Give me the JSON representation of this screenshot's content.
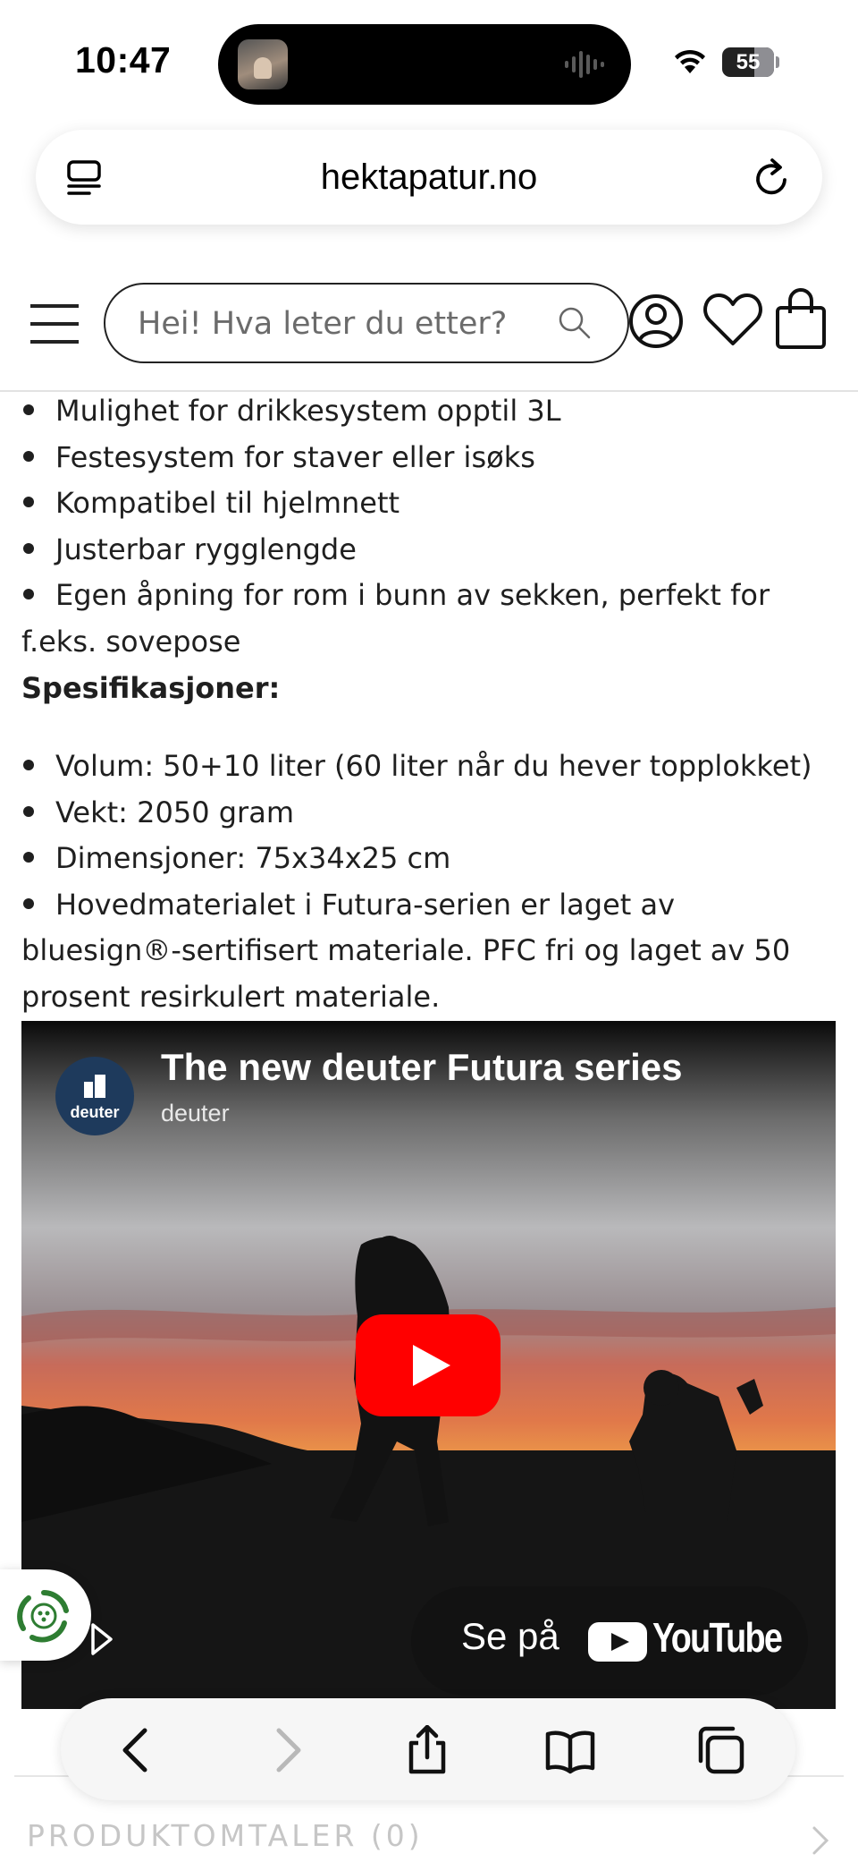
{
  "status_bar": {
    "time": "10:47",
    "battery_percent": "55"
  },
  "browser": {
    "url": "hektapatur.no"
  },
  "site_header": {
    "search_placeholder": "Hei! Hva leter du etter?"
  },
  "content": {
    "features": [
      "Mulighet for drikkesystem opptil 3L",
      "Festesystem for staver eller isøks",
      "Kompatibel til hjelmnett",
      "Justerbar rygglengde",
      "Egen åpning for rom i bunn av sekken, perfekt for f.eks. sovepose"
    ],
    "spec_heading": "Spesifikasjoner:",
    "specs": [
      "Volum: 50+10 liter (60 liter når du hever topplokket)",
      "Vekt: 2050 gram",
      "Dimensjoner: 75x34x25 cm",
      "Hovedmaterialet i Futura-serien er laget av bluesign®-sertifisert materiale. PFC fri og laget av 50 prosent resirkulert materiale."
    ]
  },
  "video": {
    "channel_avatar_text": "deuter",
    "title": "The new deuter Futura series",
    "channel": "deuter",
    "watch_on_label": "Se på",
    "youtube_wordmark": "YouTube"
  },
  "reviews": {
    "label": "PRODUKTOMTALER (0)"
  },
  "colors": {
    "youtube_red": "#ff0000",
    "brand_navy": "#1e3a5c",
    "eco_green": "#2e7d32"
  }
}
